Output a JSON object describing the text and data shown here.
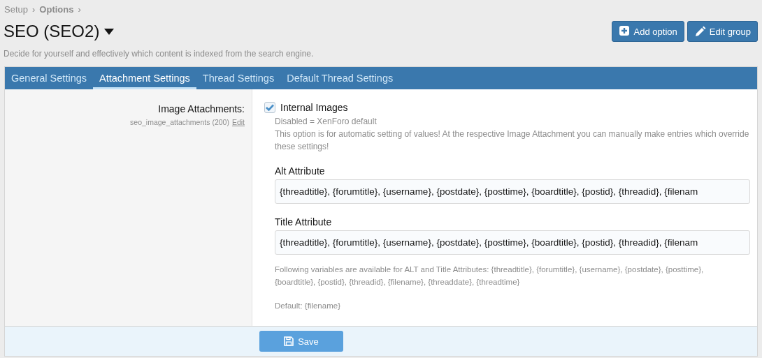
{
  "breadcrumb": [
    {
      "label": "Setup",
      "bold": false
    },
    {
      "label": "Options",
      "bold": true
    }
  ],
  "breadcrumb_separator": "›",
  "page": {
    "title": "SEO (SEO2)",
    "has_menu": true,
    "description": "Decide for yourself and effectively which content is indexed from the search engine."
  },
  "buttons": [
    {
      "kind": "add",
      "label": "Add option"
    },
    {
      "kind": "edit",
      "label": "Edit group"
    }
  ],
  "tabs": [
    {
      "label": "General Settings",
      "selected": false
    },
    {
      "label": "Attachment Settings",
      "selected": true
    },
    {
      "label": "Thread Settings",
      "selected": false
    },
    {
      "label": "Default Thread Settings",
      "selected": false
    }
  ],
  "option": {
    "label": "Image Attachments:",
    "option_id": "seo_image_attachments (200)",
    "edit_link": "Edit",
    "checkbox": {
      "label": "Internal Images",
      "checked": true
    },
    "hints": [
      "Disabled = XenForo default",
      "This option is for automatic setting of values! At the respective Image Attachment you can manually make entries which override these settings!"
    ],
    "fields": [
      {
        "label": "Alt Attribute",
        "value": "{threadtitle}, {forumtitle}, {username}, {postdate}, {posttime}, {boardtitle}, {postid}, {threadid}, {filenam"
      },
      {
        "label": "Title Attribute",
        "value": "{threadtitle}, {forumtitle}, {username}, {postdate}, {posttime}, {boardtitle}, {postid}, {threadid}, {filenam"
      }
    ],
    "explain": [
      "Following variables are available for ALT and Title Attributes: {threadtitle}, {forumtitle}, {username}, {postdate}, {posttime}, {boardtitle}, {postid}, {threadid}, {filename}, {threaddate}, {threadtime}",
      "Default: {filename}"
    ]
  },
  "save_button": {
    "label": "Save"
  }
}
